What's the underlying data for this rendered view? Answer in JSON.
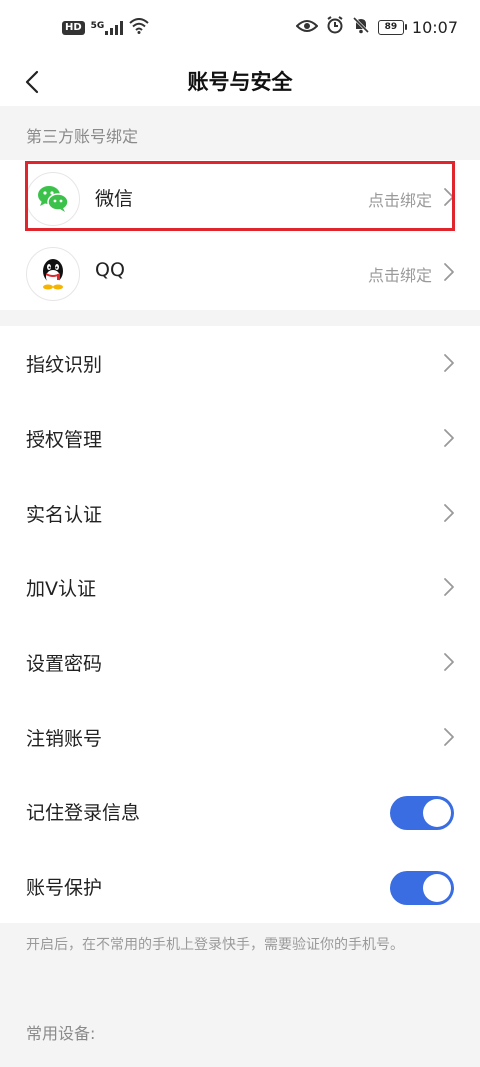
{
  "status_bar": {
    "hd": "HD",
    "network": "5G",
    "battery": "89",
    "time": "10:07"
  },
  "nav": {
    "title": "账号与安全"
  },
  "third_party": {
    "header": "第三方账号绑定",
    "items": [
      {
        "label": "微信",
        "value": "点击绑定",
        "icon": "wechat-icon"
      },
      {
        "label": "QQ",
        "value": "点击绑定",
        "icon": "qq-icon"
      }
    ]
  },
  "settings": {
    "items": [
      {
        "label": "指纹识别"
      },
      {
        "label": "授权管理"
      },
      {
        "label": "实名认证"
      },
      {
        "label": "加V认证"
      },
      {
        "label": "设置密码"
      },
      {
        "label": "注销账号"
      }
    ],
    "toggles": [
      {
        "label": "记住登录信息",
        "on": true
      },
      {
        "label": "账号保护",
        "on": true
      }
    ],
    "hint": "开启后，在不常用的手机上登录快手，需要验证你的手机号。"
  },
  "devices": {
    "header": "常用设备:"
  },
  "colors": {
    "accent": "#3a6de2",
    "highlight": "#e0262c",
    "wechat": "#3cc24b"
  }
}
